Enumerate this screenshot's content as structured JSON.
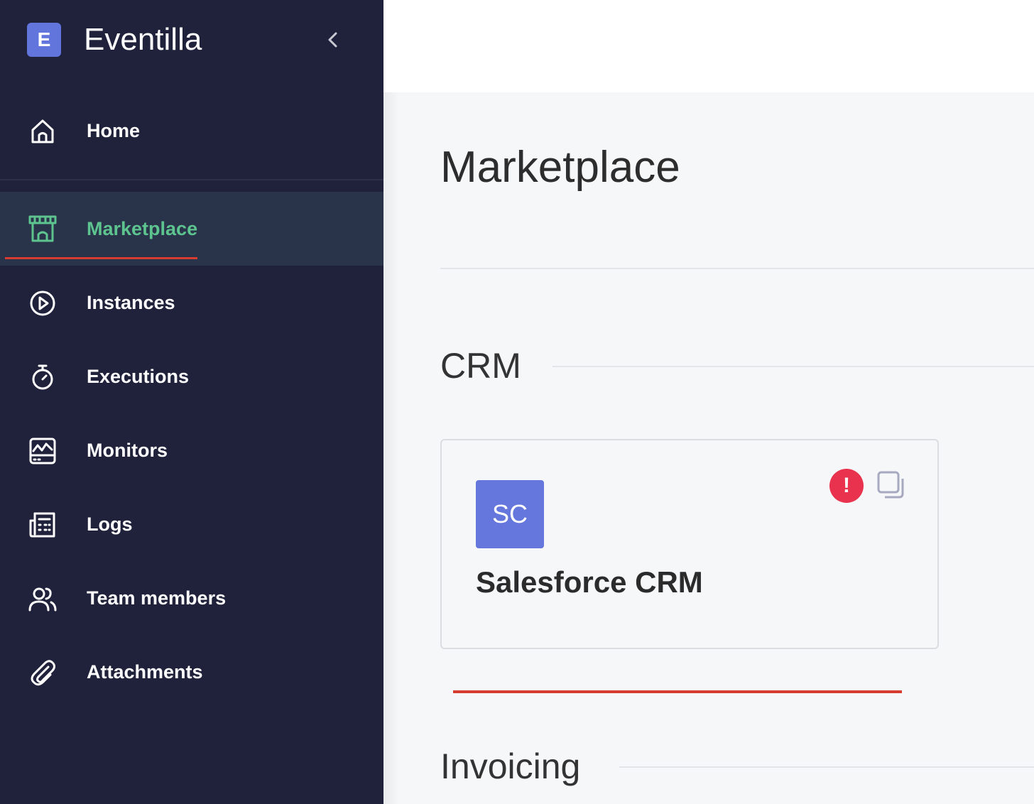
{
  "colors": {
    "sidebar_bg": "#1f223a",
    "accent": "#5dc48f",
    "underline": "#d63c2f",
    "brand": "#6175dd",
    "avatar": "#6577dc",
    "alert": "#e8324e"
  },
  "brand": {
    "logo_letter": "E",
    "name": "Eventilla",
    "collapse_icon": "chevron-left-icon"
  },
  "sidebar": {
    "items": [
      {
        "key": "home",
        "label": "Home",
        "icon": "home-icon"
      },
      {
        "key": "marketplace",
        "label": "Marketplace",
        "icon": "store-icon",
        "active": true
      },
      {
        "key": "instances",
        "label": "Instances",
        "icon": "play-circle-icon"
      },
      {
        "key": "executions",
        "label": "Executions",
        "icon": "stopwatch-icon"
      },
      {
        "key": "monitors",
        "label": "Monitors",
        "icon": "monitor-chart-icon"
      },
      {
        "key": "logs",
        "label": "Logs",
        "icon": "logs-icon"
      },
      {
        "key": "team_members",
        "label": "Team members",
        "icon": "users-icon"
      },
      {
        "key": "attachments",
        "label": "Attachments",
        "icon": "paperclip-icon"
      }
    ]
  },
  "main": {
    "title": "Marketplace",
    "sections": [
      {
        "title": "CRM",
        "cards": [
          {
            "avatar_text": "SC",
            "title": "Salesforce CRM",
            "alert_symbol": "!",
            "alert_icon": "alert-icon",
            "copy_icon": "copy-icon"
          }
        ]
      },
      {
        "title": "Invoicing",
        "cards": []
      }
    ]
  }
}
